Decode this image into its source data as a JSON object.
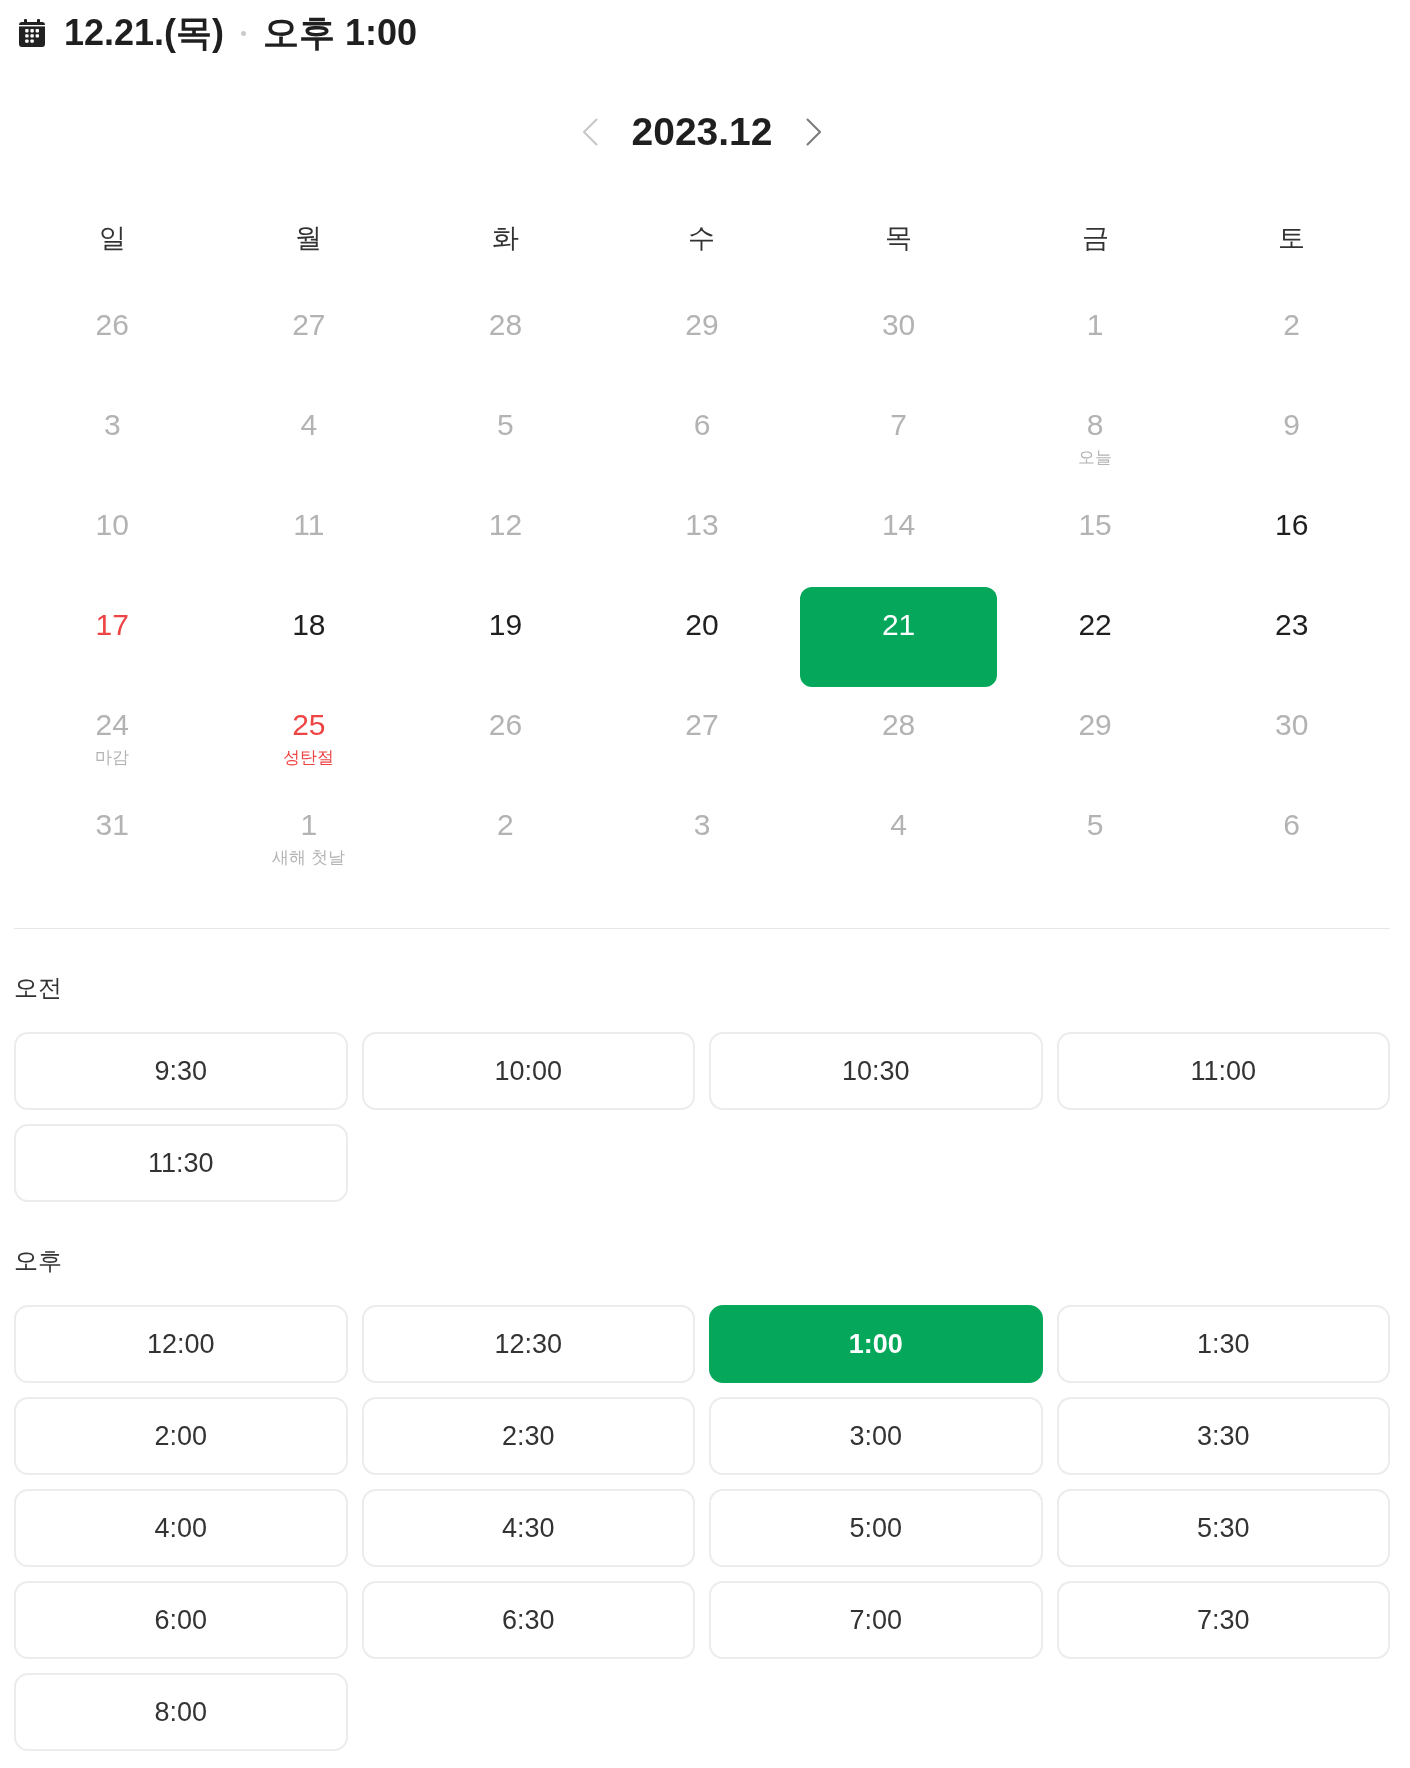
{
  "header": {
    "date": "12.21.(목)",
    "time": "오후 1:00"
  },
  "month_nav": {
    "title": "2023.12",
    "prev": {
      "disabled": true
    },
    "next": {
      "disabled": false
    }
  },
  "weekdays": [
    "일",
    "월",
    "화",
    "수",
    "목",
    "금",
    "토"
  ],
  "weeks": [
    [
      {
        "day": "26",
        "disabled": true,
        "holiday": false,
        "selected": false
      },
      {
        "day": "27",
        "disabled": true,
        "holiday": false,
        "selected": false
      },
      {
        "day": "28",
        "disabled": true,
        "holiday": false,
        "selected": false
      },
      {
        "day": "29",
        "disabled": true,
        "holiday": false,
        "selected": false
      },
      {
        "day": "30",
        "disabled": true,
        "holiday": false,
        "selected": false
      },
      {
        "day": "1",
        "disabled": true,
        "holiday": false,
        "selected": false
      },
      {
        "day": "2",
        "disabled": true,
        "holiday": false,
        "selected": false
      }
    ],
    [
      {
        "day": "3",
        "disabled": true,
        "holiday": false,
        "selected": false
      },
      {
        "day": "4",
        "disabled": true,
        "holiday": false,
        "selected": false
      },
      {
        "day": "5",
        "disabled": true,
        "holiday": false,
        "selected": false
      },
      {
        "day": "6",
        "disabled": true,
        "holiday": false,
        "selected": false
      },
      {
        "day": "7",
        "disabled": true,
        "holiday": false,
        "selected": false
      },
      {
        "day": "8",
        "note": "오늘",
        "disabled": true,
        "holiday": false,
        "selected": false
      },
      {
        "day": "9",
        "disabled": true,
        "holiday": false,
        "selected": false
      }
    ],
    [
      {
        "day": "10",
        "disabled": true,
        "holiday": false,
        "selected": false
      },
      {
        "day": "11",
        "disabled": true,
        "holiday": false,
        "selected": false
      },
      {
        "day": "12",
        "disabled": true,
        "holiday": false,
        "selected": false
      },
      {
        "day": "13",
        "disabled": true,
        "holiday": false,
        "selected": false
      },
      {
        "day": "14",
        "disabled": true,
        "holiday": false,
        "selected": false
      },
      {
        "day": "15",
        "disabled": true,
        "holiday": false,
        "selected": false
      },
      {
        "day": "16",
        "disabled": false,
        "holiday": false,
        "selected": false
      }
    ],
    [
      {
        "day": "17",
        "disabled": false,
        "holiday": true,
        "selected": false
      },
      {
        "day": "18",
        "disabled": false,
        "holiday": false,
        "selected": false
      },
      {
        "day": "19",
        "disabled": false,
        "holiday": false,
        "selected": false
      },
      {
        "day": "20",
        "disabled": false,
        "holiday": false,
        "selected": false
      },
      {
        "day": "21",
        "disabled": false,
        "holiday": false,
        "selected": true
      },
      {
        "day": "22",
        "disabled": false,
        "holiday": false,
        "selected": false
      },
      {
        "day": "23",
        "disabled": false,
        "holiday": false,
        "selected": false
      }
    ],
    [
      {
        "day": "24",
        "note": "마감",
        "disabled": true,
        "holiday": false,
        "selected": false
      },
      {
        "day": "25",
        "note": "성탄절",
        "disabled": false,
        "holiday": true,
        "selected": false
      },
      {
        "day": "26",
        "disabled": true,
        "holiday": false,
        "selected": false
      },
      {
        "day": "27",
        "disabled": true,
        "holiday": false,
        "selected": false
      },
      {
        "day": "28",
        "disabled": true,
        "holiday": false,
        "selected": false
      },
      {
        "day": "29",
        "disabled": true,
        "holiday": false,
        "selected": false
      },
      {
        "day": "30",
        "disabled": true,
        "holiday": false,
        "selected": false
      }
    ],
    [
      {
        "day": "31",
        "disabled": true,
        "holiday": false,
        "selected": false
      },
      {
        "day": "1",
        "note": "새해 첫날",
        "disabled": true,
        "holiday": false,
        "selected": false
      },
      {
        "day": "2",
        "disabled": true,
        "holiday": false,
        "selected": false
      },
      {
        "day": "3",
        "disabled": true,
        "holiday": false,
        "selected": false
      },
      {
        "day": "4",
        "disabled": true,
        "holiday": false,
        "selected": false
      },
      {
        "day": "5",
        "disabled": true,
        "holiday": false,
        "selected": false
      },
      {
        "day": "6",
        "disabled": true,
        "holiday": false,
        "selected": false
      }
    ]
  ],
  "time_groups": [
    {
      "label": "오전",
      "slots": [
        {
          "time": "9:30",
          "selected": false
        },
        {
          "time": "10:00",
          "selected": false
        },
        {
          "time": "10:30",
          "selected": false
        },
        {
          "time": "11:00",
          "selected": false
        },
        {
          "time": "11:30",
          "selected": false
        }
      ]
    },
    {
      "label": "오후",
      "slots": [
        {
          "time": "12:00",
          "selected": false
        },
        {
          "time": "12:30",
          "selected": false
        },
        {
          "time": "1:00",
          "selected": true
        },
        {
          "time": "1:30",
          "selected": false
        },
        {
          "time": "2:00",
          "selected": false
        },
        {
          "time": "2:30",
          "selected": false
        },
        {
          "time": "3:00",
          "selected": false
        },
        {
          "time": "3:30",
          "selected": false
        },
        {
          "time": "4:00",
          "selected": false
        },
        {
          "time": "4:30",
          "selected": false
        },
        {
          "time": "5:00",
          "selected": false
        },
        {
          "time": "5:30",
          "selected": false
        },
        {
          "time": "6:00",
          "selected": false
        },
        {
          "time": "6:30",
          "selected": false
        },
        {
          "time": "7:00",
          "selected": false
        },
        {
          "time": "7:30",
          "selected": false
        },
        {
          "time": "8:00",
          "selected": false
        }
      ]
    }
  ]
}
